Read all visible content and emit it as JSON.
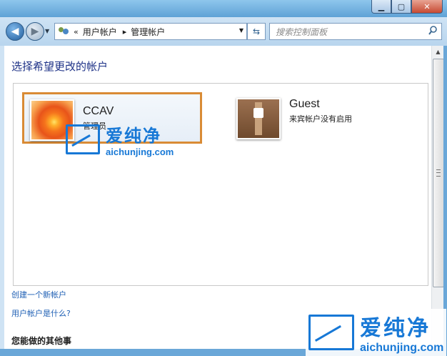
{
  "window": {
    "minimize_glyph": "▁",
    "maximize_glyph": "▢",
    "close_glyph": "✕"
  },
  "toolbar": {
    "back_glyph": "◀",
    "forward_glyph": "▶",
    "dropdown_glyph": "▼",
    "address_prefix": "«",
    "breadcrumb": [
      "用户帐户",
      "管理帐户"
    ],
    "breadcrumb_sep": "▸",
    "refresh_glyph": "⇆",
    "search_placeholder": "搜索控制面板"
  },
  "main": {
    "heading": "选择希望更改的帐户",
    "accounts": [
      {
        "name": "CCAV",
        "role": "管理员",
        "icon": "flower-avatar-icon",
        "selected": true
      },
      {
        "name": "Guest",
        "role": "来宾帐户没有启用",
        "icon": "guest-suitcase-icon",
        "selected": false
      }
    ],
    "links": [
      "创建一个新帐户",
      "用户帐户是什么?"
    ],
    "other_heading": "您能做的其他事"
  },
  "scrollbar": {
    "up_glyph": "▲"
  },
  "watermark": {
    "cn": "爱纯净",
    "en": "aichunjing.com"
  },
  "colors": {
    "selection_border": "#d98b35",
    "link": "#1e5fb4",
    "heading": "#1e3287",
    "watermark": "#1778d6"
  }
}
